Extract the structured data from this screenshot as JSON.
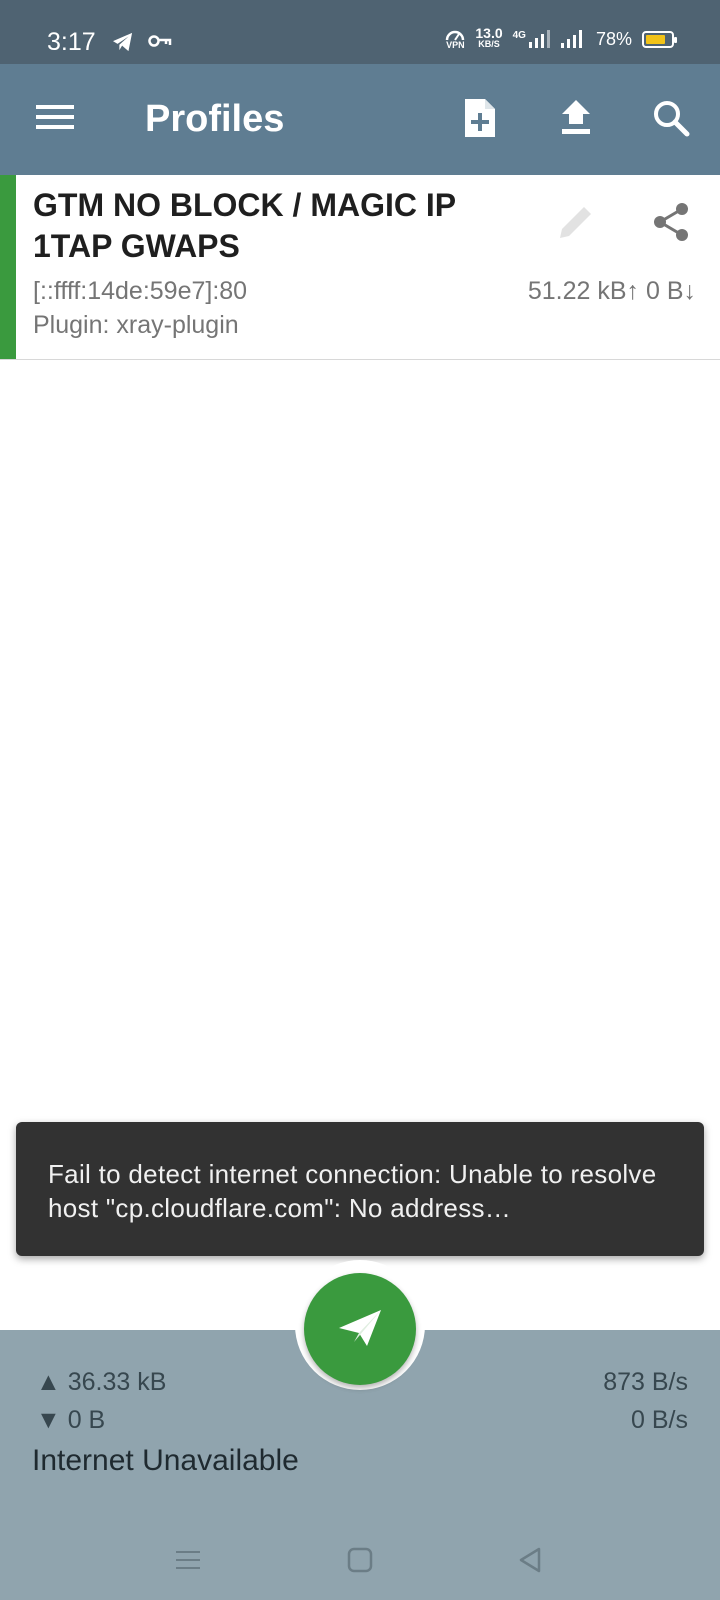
{
  "status_bar": {
    "time": "3:17",
    "vpn_label": "VPN",
    "net_speed_value": "13.0",
    "net_speed_unit": "KB/S",
    "network_type": "4G",
    "battery_percent": "78%",
    "battery_level": 0.78,
    "battery_color": "#f2c318"
  },
  "app_bar": {
    "title": "Profiles",
    "menu_icon": "menu-icon",
    "actions": [
      "add-file-icon",
      "upload-icon",
      "search-icon"
    ],
    "background": "#5f7d92"
  },
  "profile": {
    "name": "GTM NO BLOCK / MAGIC IP 1TAP GWAPS",
    "host": "[::ffff:14de:59e7]:80",
    "plugin": "Plugin: xray-plugin",
    "traffic": "51.22 kB↑  0 B↓",
    "active_color": "#3a9a3e"
  },
  "toast": {
    "message": "Fail to detect internet connection: Unable to resolve host \"cp.cloudflare.com\": No address…"
  },
  "stats": {
    "upload_total": "▲ 36.33 kB",
    "download_total": "▼ 0 B",
    "upload_rate": "873 B/s",
    "download_rate": "0 B/s",
    "connection_status": "Internet Unavailable"
  },
  "fab": {
    "icon": "paper-plane-icon",
    "color": "#3a9a3e"
  },
  "nav": {
    "icons": [
      "recents-icon",
      "home-icon",
      "back-icon"
    ]
  }
}
